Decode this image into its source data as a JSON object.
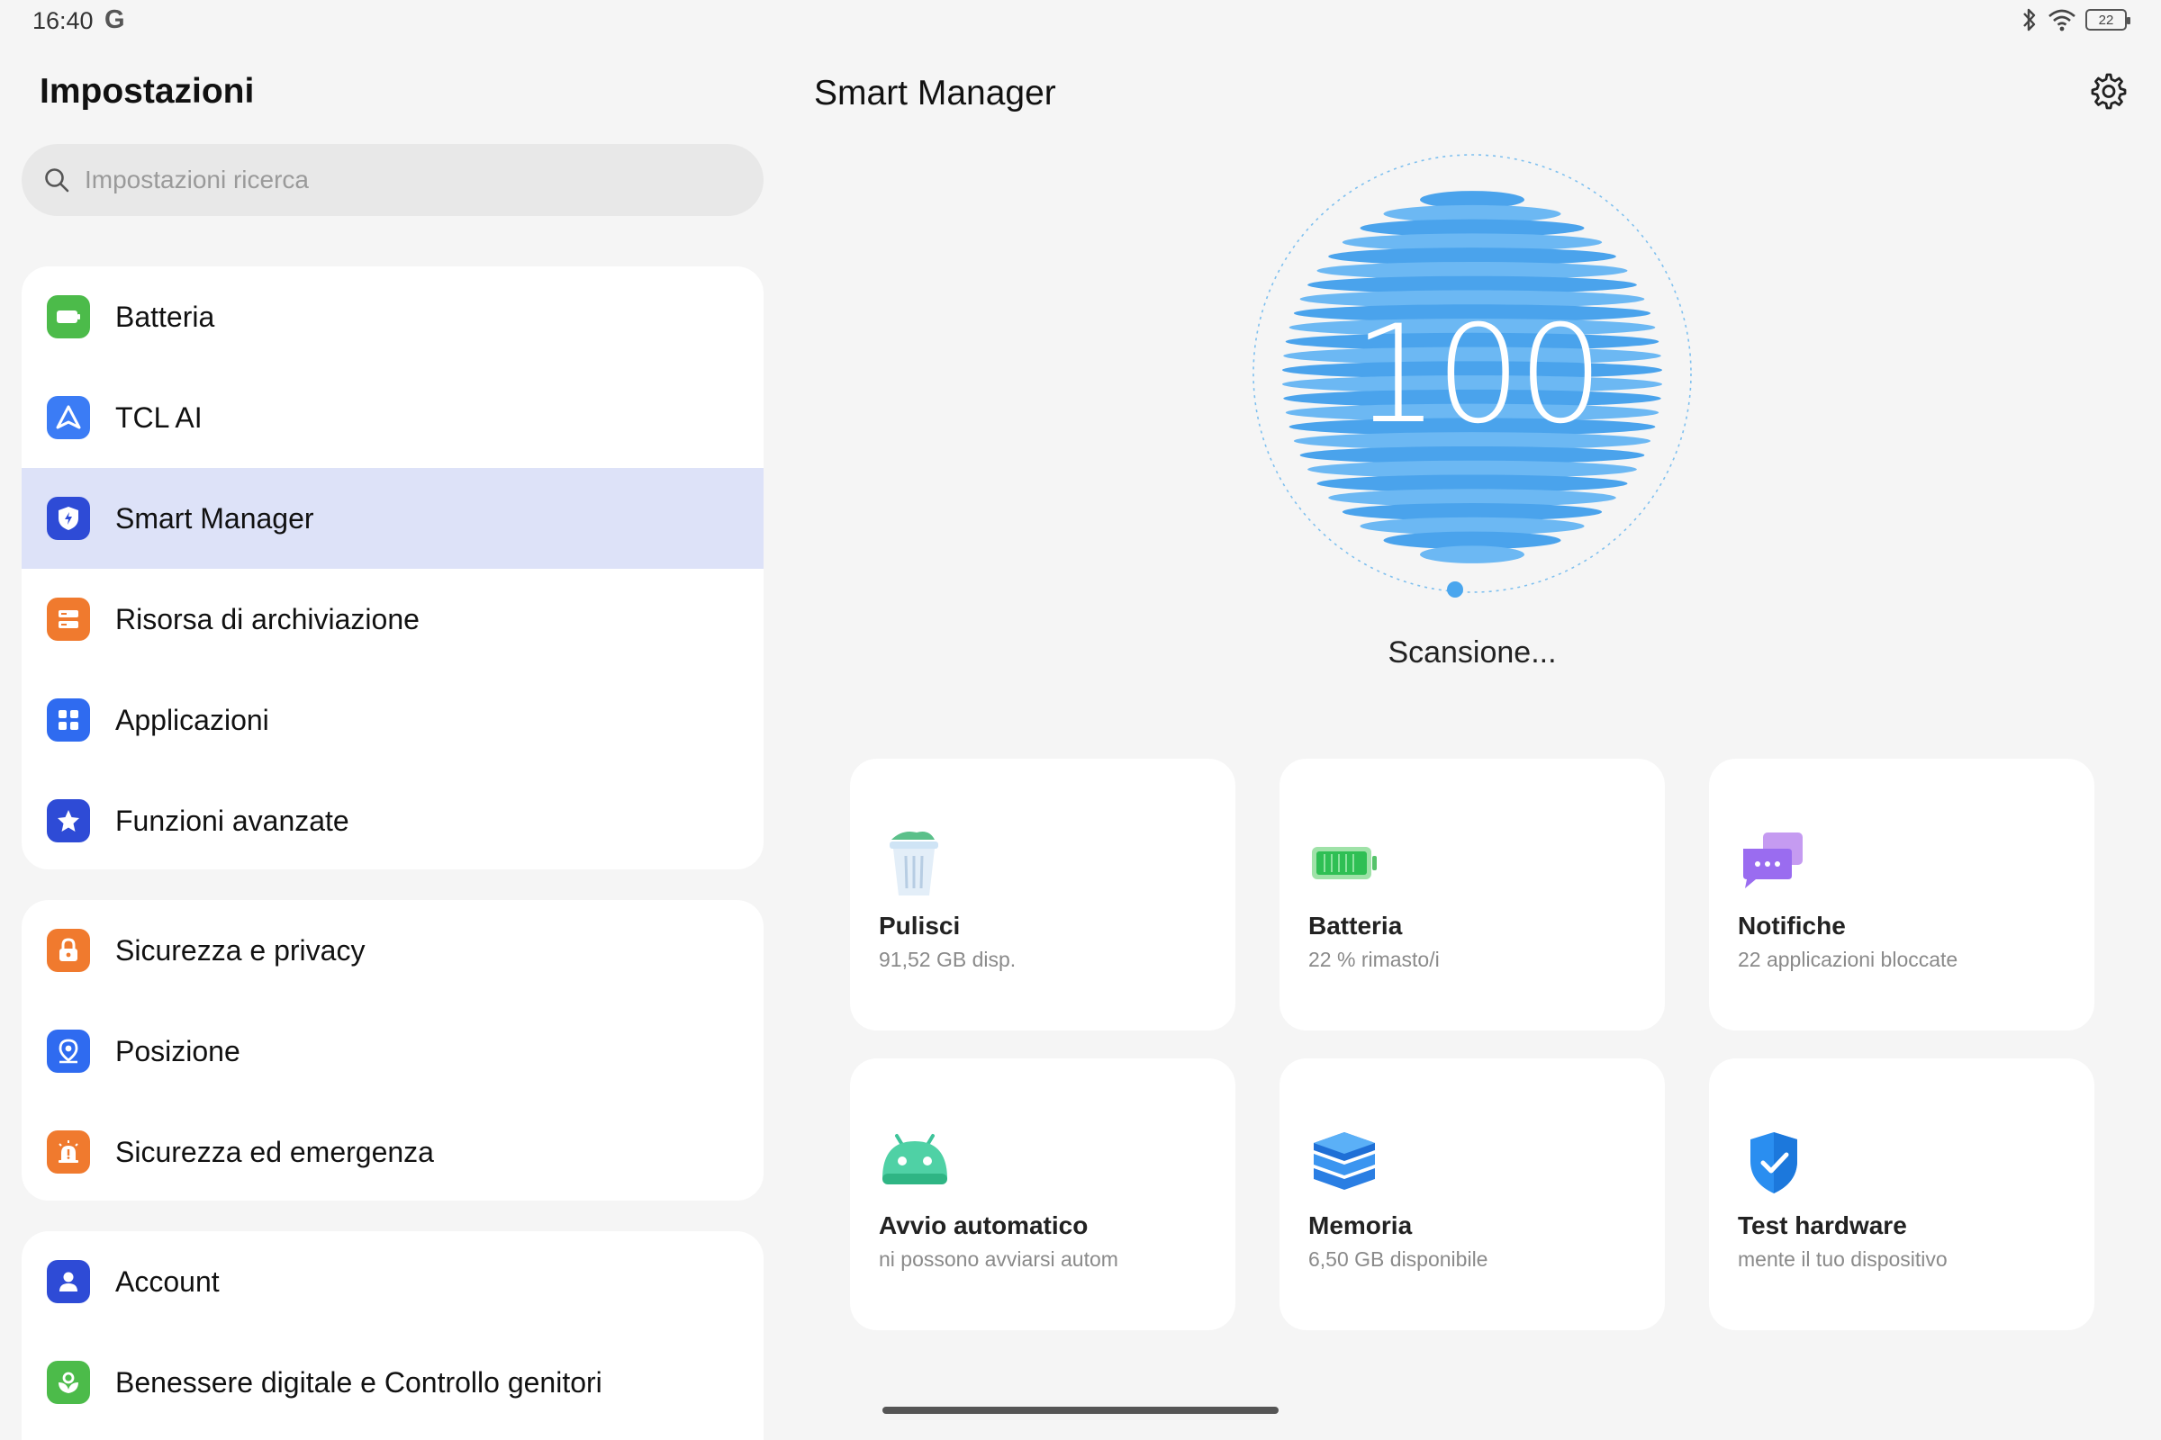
{
  "status_bar": {
    "time": "16:40",
    "g_logo": "G",
    "battery_level": "22",
    "icons": [
      "bluetooth-icon",
      "wifi-icon",
      "battery-icon"
    ]
  },
  "left_pane": {
    "title": "Impostazioni",
    "search_placeholder": "Impostazioni ricerca",
    "groups": [
      {
        "items": [
          {
            "label": "Batteria",
            "icon": "battery-icon",
            "color": "#4cbb4a"
          },
          {
            "label": "TCL AI",
            "icon": "tcl-ai-icon",
            "color": "#3b7cf5"
          },
          {
            "label": "Smart Manager",
            "icon": "shield-icon",
            "color": "#2e4bd6",
            "selected": true
          },
          {
            "label": "Risorsa di archiviazione",
            "icon": "storage-icon",
            "color": "#f07a2e"
          },
          {
            "label": "Applicazioni",
            "icon": "apps-icon",
            "color": "#2f6bf0"
          },
          {
            "label": "Funzioni avanzate",
            "icon": "star-icon",
            "color": "#2e4bd6"
          }
        ]
      },
      {
        "items": [
          {
            "label": "Sicurezza e privacy",
            "icon": "lock-icon",
            "color": "#f07a2e"
          },
          {
            "label": "Posizione",
            "icon": "location-icon",
            "color": "#2f6bf0"
          },
          {
            "label": "Sicurezza ed emergenza",
            "icon": "emergency-icon",
            "color": "#f07a2e"
          }
        ]
      },
      {
        "items": [
          {
            "label": "Account",
            "icon": "person-icon",
            "color": "#2e4bd6"
          },
          {
            "label": "Benessere digitale e Controllo genitori",
            "icon": "wellbeing-icon",
            "color": "#4cbb4a"
          }
        ]
      }
    ]
  },
  "right_pane": {
    "title": "Smart Manager",
    "score": "100",
    "scan_status": "Scansione...",
    "cards": [
      {
        "title": "Pulisci",
        "subtitle": "91,52 GB disp.",
        "icon": "trash-icon"
      },
      {
        "title": "Batteria",
        "subtitle": "22 % rimasto/i",
        "icon": "battery-icon"
      },
      {
        "title": "Notifiche",
        "subtitle": "22 applicazioni bloccate",
        "icon": "notification-icon"
      },
      {
        "title": "Avvio automatico",
        "subtitle": "ni possono avviarsi autom",
        "icon": "android-icon"
      },
      {
        "title": "Memoria",
        "subtitle": "6,50 GB disponibile",
        "icon": "memory-icon"
      },
      {
        "title": "Test hardware",
        "subtitle": "mente il tuo dispositivo",
        "icon": "shield-check-icon"
      }
    ]
  },
  "colors": {
    "accent": "#2e4bd6",
    "selected_bg": "#dde2f8",
    "orb_blue": "#4aa6ee",
    "background": "#f5f5f5"
  }
}
